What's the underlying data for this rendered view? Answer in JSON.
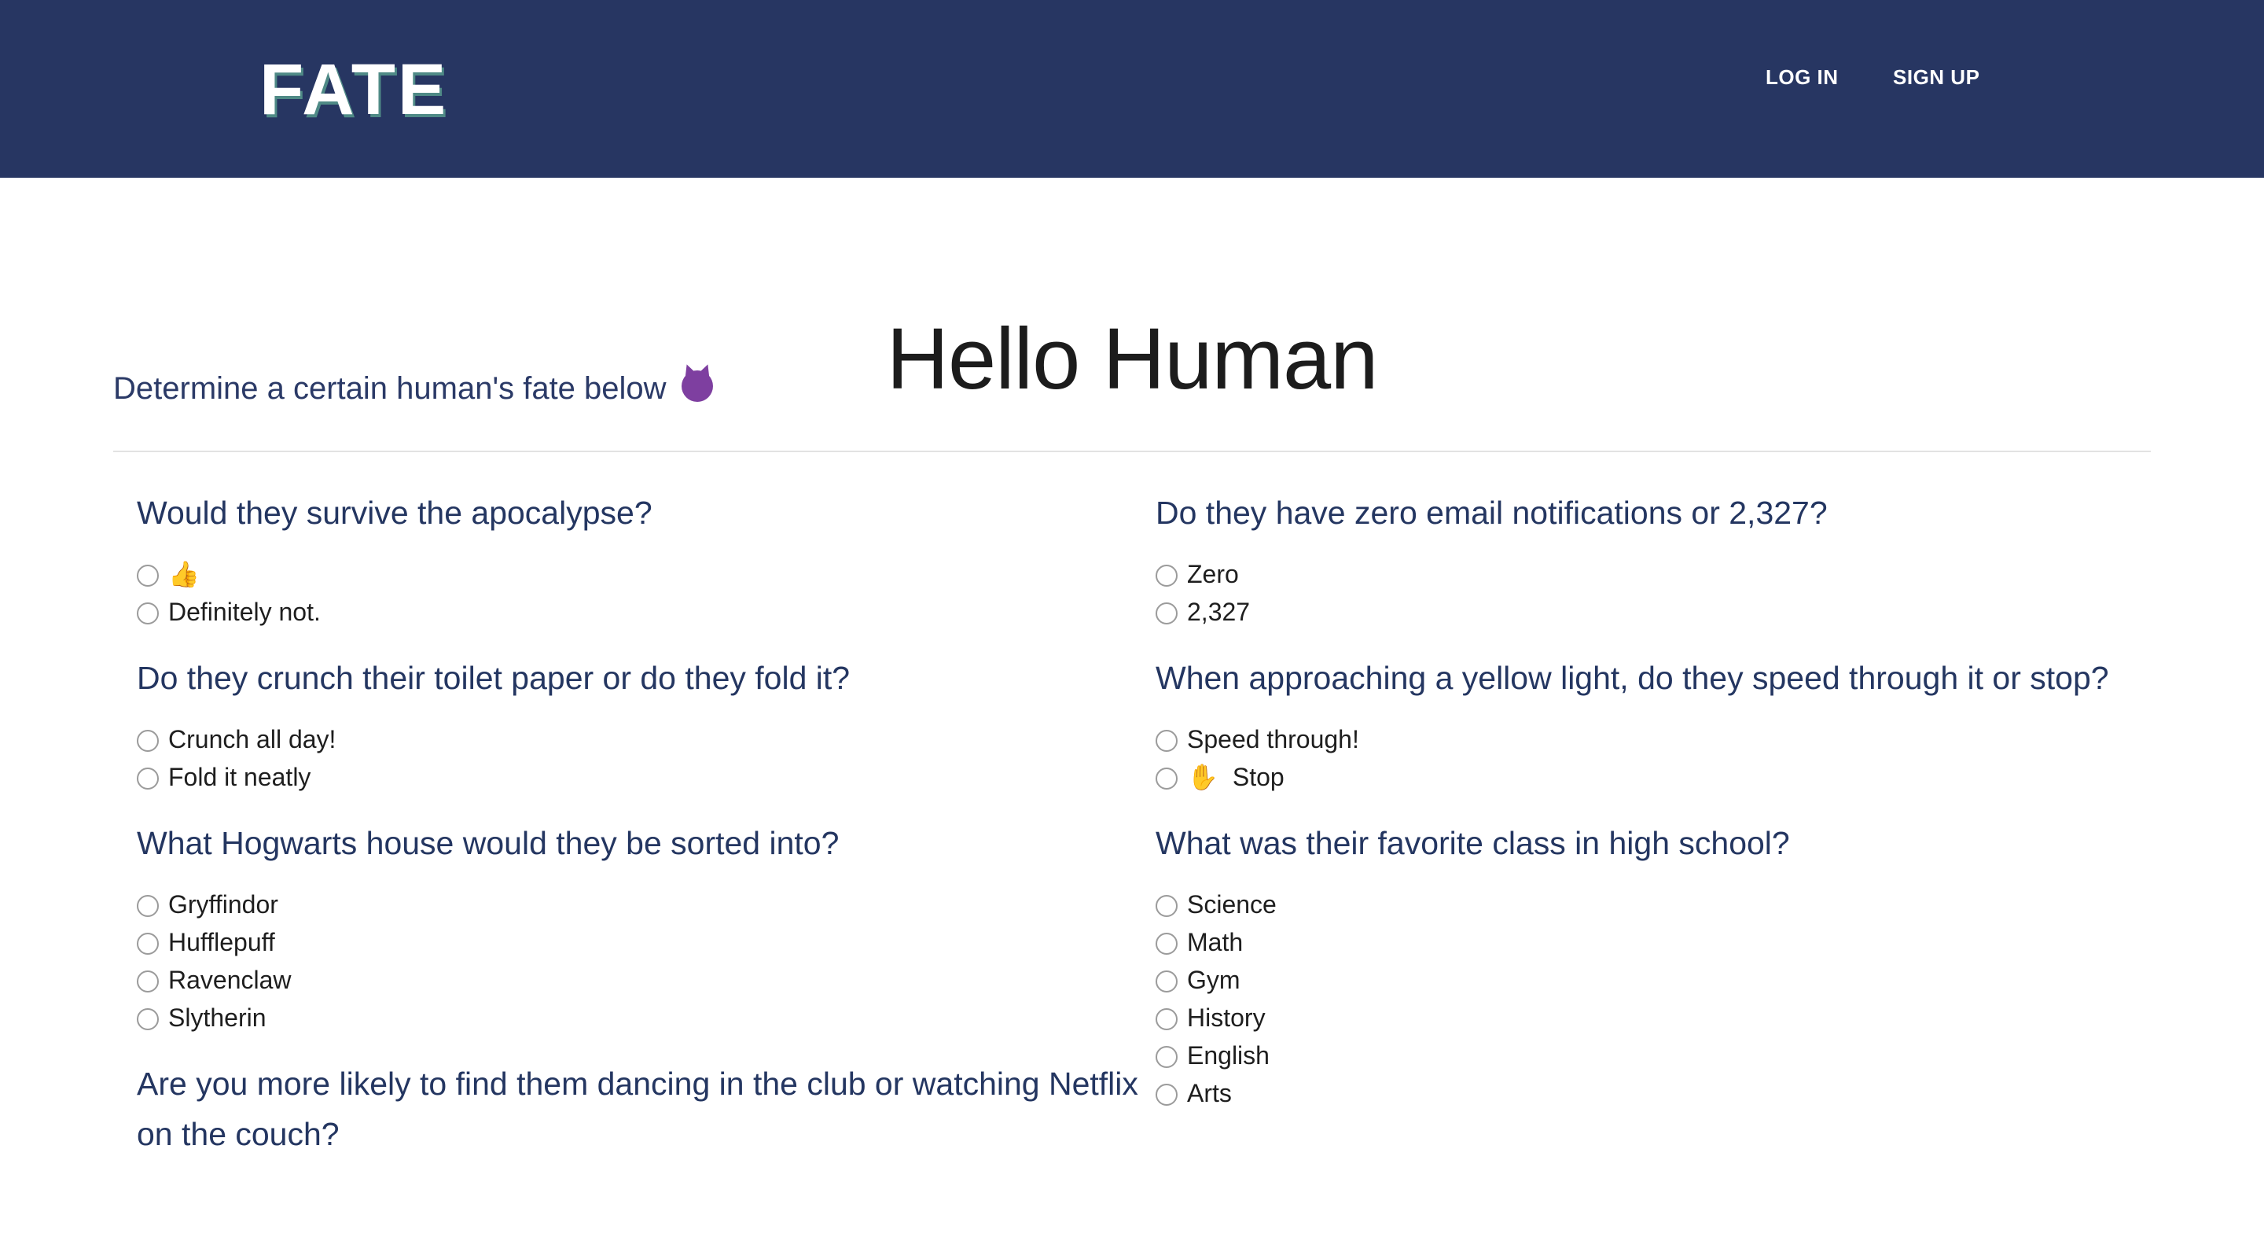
{
  "header": {
    "logo": "FATE",
    "nav": {
      "login": "LOG IN",
      "signup": "SIGN UP"
    },
    "colors": {
      "navbar": "#273662",
      "logo_shadow": "#4f8a86"
    }
  },
  "main": {
    "title": "Hello Human",
    "subtitle": "Determine a certain human's fate below",
    "subtitle_icon": "smiling-devil-emoji"
  },
  "questions_left": [
    {
      "text": "Would they survive the apocalypse?",
      "options": [
        "👍",
        "Definitely not."
      ]
    },
    {
      "text": "Do they crunch their toilet paper or do they fold it?",
      "options": [
        "Crunch all day!",
        "Fold it neatly"
      ]
    },
    {
      "text": "What Hogwarts house would they be sorted into?",
      "options": [
        "Gryffindor",
        "Hufflepuff",
        "Ravenclaw",
        "Slytherin"
      ]
    },
    {
      "text": "Are you more likely to find them dancing in the club or watching Netflix on the couch?",
      "options": []
    }
  ],
  "questions_right": [
    {
      "text": "Do they have zero email notifications or 2,327?",
      "options": [
        "Zero",
        "2,327"
      ]
    },
    {
      "text": "When approaching a yellow light, do they speed through it or stop?",
      "options": [
        "Speed through!",
        "Stop"
      ],
      "option_icons": [
        "",
        "raised-hand-emoji"
      ]
    },
    {
      "text": "What was their favorite class in high school?",
      "options": [
        "Science",
        "Math",
        "Gym",
        "History",
        "English",
        "Arts"
      ]
    }
  ]
}
